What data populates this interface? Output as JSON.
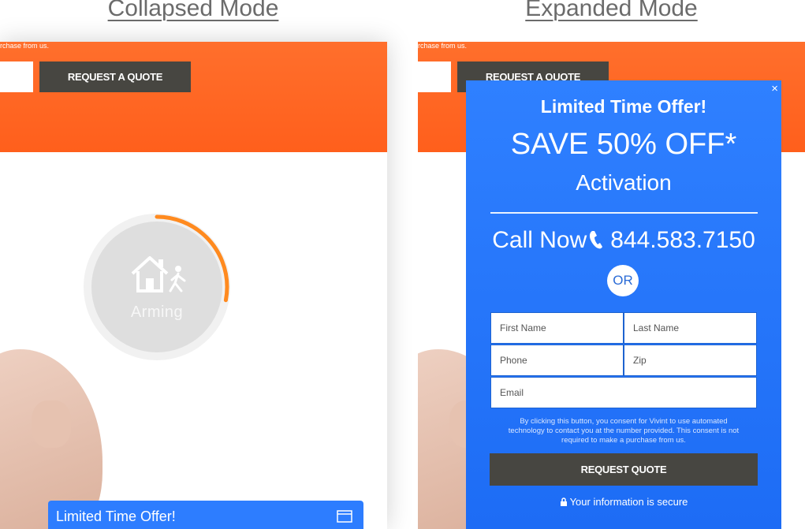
{
  "labels": {
    "collapsed_mode": "Collapsed Mode",
    "expanded_mode": "Expanded Mode"
  },
  "site": {
    "consent_snippet_left": "rchase from us.",
    "consent_snippet_right": "rchase from us.",
    "request_quote_button": "REQUEST A QUOTE"
  },
  "arming_widget": {
    "status": "Arming",
    "progress": 0.28,
    "accent": "#ff8a1f"
  },
  "collapsed_bar": {
    "title": "Limited Time Offer!"
  },
  "modal": {
    "kicker": "Limited Time Offer!",
    "headline": "SAVE 50% OFF*",
    "subheadline": "Activation",
    "call_label": "Call Now",
    "phone_number": "844.583.7150",
    "or_label": "OR",
    "fields": {
      "first_name": "First Name",
      "last_name": "Last Name",
      "phone": "Phone",
      "zip": "Zip",
      "email": "Email"
    },
    "consent_text": "By clicking this button, you consent for Vivint to use automated technology to contact you at the number provided. This consent is not required to make a purchase from us.",
    "submit_label": "REQUEST QUOTE",
    "secure_text": "Your information is secure",
    "close_glyph": "×"
  },
  "colors": {
    "header_orange": "#ff6a26",
    "modal_blue": "#2a7bff",
    "button_dark": "#474641"
  }
}
